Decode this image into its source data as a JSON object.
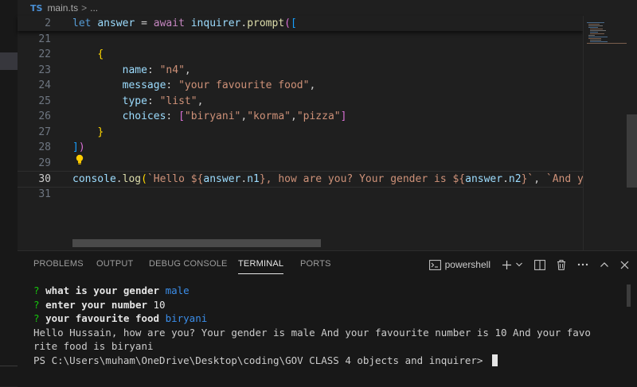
{
  "breadcrumb": {
    "lang_badge": "TS",
    "file": "main.ts",
    "separator": ">",
    "more": "..."
  },
  "editor": {
    "lines": [
      {
        "num": "2",
        "parts": [
          [
            "kw",
            "let "
          ],
          [
            "var",
            "answer"
          ],
          [
            "pun",
            " = "
          ],
          [
            "kw2",
            "await "
          ],
          [
            "var",
            "inquirer"
          ],
          [
            "pun",
            "."
          ],
          [
            "fn",
            "prompt"
          ],
          [
            "br1",
            "("
          ],
          [
            "br2",
            "["
          ]
        ]
      },
      {
        "num": "21",
        "parts": []
      },
      {
        "num": "22",
        "parts": [
          [
            "pun",
            "    "
          ],
          [
            "br3",
            "{"
          ]
        ]
      },
      {
        "num": "23",
        "parts": [
          [
            "pun",
            "        "
          ],
          [
            "prop",
            "name"
          ],
          [
            "pun",
            ": "
          ],
          [
            "str",
            "\"n4\""
          ],
          [
            "pun",
            ","
          ]
        ]
      },
      {
        "num": "24",
        "parts": [
          [
            "pun",
            "        "
          ],
          [
            "prop",
            "message"
          ],
          [
            "pun",
            ": "
          ],
          [
            "str",
            "\"your favourite food\""
          ],
          [
            "pun",
            ","
          ]
        ]
      },
      {
        "num": "25",
        "parts": [
          [
            "pun",
            "        "
          ],
          [
            "prop",
            "type"
          ],
          [
            "pun",
            ": "
          ],
          [
            "str",
            "\"list\""
          ],
          [
            "pun",
            ","
          ]
        ]
      },
      {
        "num": "26",
        "parts": [
          [
            "pun",
            "        "
          ],
          [
            "prop",
            "choices"
          ],
          [
            "pun",
            ": "
          ],
          [
            "br1",
            "["
          ],
          [
            "str",
            "\"biryani\""
          ],
          [
            "pun",
            ","
          ],
          [
            "str",
            "\"korma\""
          ],
          [
            "pun",
            ","
          ],
          [
            "str",
            "\"pizza\""
          ],
          [
            "br1",
            "]"
          ]
        ]
      },
      {
        "num": "27",
        "parts": [
          [
            "pun",
            "    "
          ],
          [
            "br3",
            "}"
          ]
        ]
      },
      {
        "num": "28",
        "parts": [
          [
            "br2",
            "]"
          ],
          [
            "br1",
            ")"
          ]
        ]
      },
      {
        "num": "29",
        "parts": []
      },
      {
        "num": "30",
        "parts": [
          [
            "var",
            "console"
          ],
          [
            "pun",
            "."
          ],
          [
            "fn",
            "log"
          ],
          [
            "br3",
            "("
          ],
          [
            "str",
            "`Hello ${"
          ],
          [
            "var",
            "answer"
          ],
          [
            "pun",
            "."
          ],
          [
            "var",
            "n1"
          ],
          [
            "str",
            "}, how are you? Your gender is ${"
          ],
          [
            "var",
            "answer"
          ],
          [
            "pun",
            "."
          ],
          [
            "var",
            "n2"
          ],
          [
            "str",
            "}`"
          ],
          [
            "pun",
            ", "
          ],
          [
            "str",
            "`And y"
          ]
        ]
      },
      {
        "num": "31",
        "parts": []
      }
    ],
    "active_line": "30"
  },
  "panel": {
    "tabs": [
      "PROBLEMS",
      "OUTPUT",
      "DEBUG CONSOLE",
      "TERMINAL",
      "PORTS"
    ],
    "active_tab": "TERMINAL",
    "shell": "powershell"
  },
  "terminal": {
    "lines": [
      {
        "q": "?",
        "prompt": "what is your gender",
        "answer": "male",
        "answer_style": "ans"
      },
      {
        "q": "?",
        "prompt": "enter your number",
        "answer": "10",
        "answer_style": "num"
      },
      {
        "q": "?",
        "prompt": "your favourite food",
        "answer": "biryani",
        "answer_style": "ans"
      },
      {
        "text": "Hello Hussain, how are you? Your gender is male And your favourite number is 10 And your favo"
      },
      {
        "text": "rite food is biryani"
      },
      {
        "text": "PS C:\\Users\\muham\\OneDrive\\Desktop\\coding\\GOV CLASS 4 objects and inquirer> ",
        "cursor": true
      }
    ]
  },
  "colors": {
    "background": "#1f1f1f",
    "keyword": "#569cd6",
    "string": "#ce9178",
    "function": "#dcdcaa",
    "variable": "#9cdcfe",
    "terminal_question": "#16c60c",
    "terminal_answer": "#3b8eea"
  }
}
